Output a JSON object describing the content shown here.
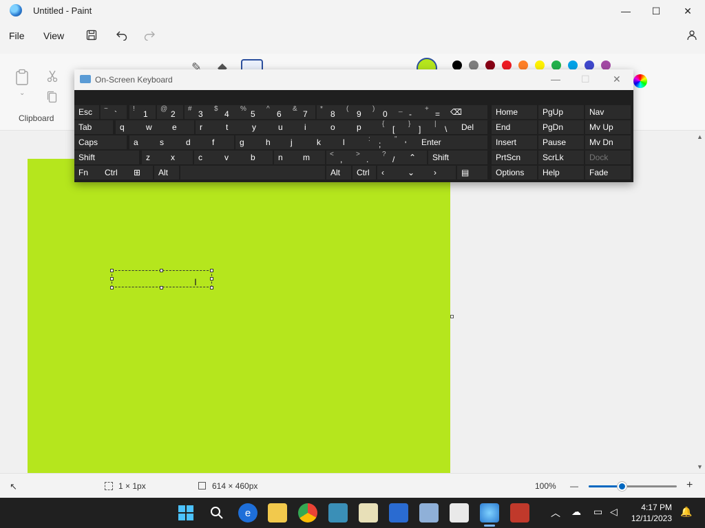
{
  "window": {
    "title": "Untitled - Paint",
    "minimize": "—",
    "maximize": "☐",
    "close": "✕"
  },
  "menu": {
    "file": "File",
    "view": "View"
  },
  "ribbon": {
    "clipboard_label": "Clipboard"
  },
  "palette": {
    "current": "#b5e61d",
    "swatches": [
      "#000000",
      "#7f7f7f",
      "#880015",
      "#ed1c24",
      "#ff7f27",
      "#fff200",
      "#22b14c",
      "#00a2e8",
      "#3f48cc",
      "#a349a4"
    ]
  },
  "status": {
    "selection_size": "1 × 1px",
    "canvas_size": "614 × 460px",
    "zoom": "100%",
    "zoom_minus": "—",
    "zoom_plus": "+",
    "zoom_level": 0.38
  },
  "osk": {
    "title": "On-Screen Keyboard",
    "row1": [
      {
        "label": "Esc"
      },
      {
        "shift": "~",
        "main": "`"
      },
      {
        "shift": "!",
        "main": "1"
      },
      {
        "shift": "@",
        "main": "2"
      },
      {
        "shift": "#",
        "main": "3"
      },
      {
        "shift": "$",
        "main": "4"
      },
      {
        "shift": "%",
        "main": "5"
      },
      {
        "shift": "^",
        "main": "6"
      },
      {
        "shift": "&",
        "main": "7"
      },
      {
        "shift": "*",
        "main": "8"
      },
      {
        "shift": "(",
        "main": "9"
      },
      {
        "shift": ")",
        "main": "0"
      },
      {
        "shift": "_",
        "main": "-"
      },
      {
        "shift": "+",
        "main": "="
      },
      {
        "label": "⌫"
      }
    ],
    "row2": [
      {
        "label": "Tab"
      },
      {
        "label": "q"
      },
      {
        "label": "w"
      },
      {
        "label": "e"
      },
      {
        "label": "r"
      },
      {
        "label": "t"
      },
      {
        "label": "y"
      },
      {
        "label": "u"
      },
      {
        "label": "i"
      },
      {
        "label": "o"
      },
      {
        "label": "p"
      },
      {
        "shift": "{",
        "main": "["
      },
      {
        "shift": "}",
        "main": "]"
      },
      {
        "shift": "|",
        "main": "\\"
      },
      {
        "label": "Del"
      }
    ],
    "row3": [
      {
        "label": "Caps"
      },
      {
        "label": "a"
      },
      {
        "label": "s"
      },
      {
        "label": "d"
      },
      {
        "label": "f"
      },
      {
        "label": "g"
      },
      {
        "label": "h"
      },
      {
        "label": "j"
      },
      {
        "label": "k"
      },
      {
        "label": "l"
      },
      {
        "shift": ":",
        "main": ";"
      },
      {
        "shift": "\"",
        "main": "'"
      },
      {
        "label": "Enter"
      }
    ],
    "row4": [
      {
        "label": "Shift"
      },
      {
        "label": "z"
      },
      {
        "label": "x"
      },
      {
        "label": "c"
      },
      {
        "label": "v"
      },
      {
        "label": "b"
      },
      {
        "label": "n"
      },
      {
        "label": "m"
      },
      {
        "shift": "<",
        "main": ","
      },
      {
        "shift": ">",
        "main": "."
      },
      {
        "shift": "?",
        "main": "/"
      },
      {
        "label": "⌃"
      },
      {
        "label": "Shift"
      }
    ],
    "row5": [
      {
        "label": "Fn"
      },
      {
        "label": "Ctrl"
      },
      {
        "label": "⊞"
      },
      {
        "label": "Alt"
      },
      {
        "label": ""
      },
      {
        "label": "Alt"
      },
      {
        "label": "Ctrl"
      },
      {
        "label": "‹"
      },
      {
        "label": "⌄"
      },
      {
        "label": "›"
      },
      {
        "label": "▤"
      }
    ],
    "nav": [
      [
        "Home",
        "PgUp",
        "Nav"
      ],
      [
        "End",
        "PgDn",
        "Mv Up"
      ],
      [
        "Insert",
        "Pause",
        "Mv Dn"
      ],
      [
        "PrtScn",
        "ScrLk",
        "Dock"
      ],
      [
        "Options",
        "Help",
        "Fade"
      ]
    ]
  },
  "taskbar": {
    "time": "4:17 PM",
    "date": "12/11/2023"
  }
}
